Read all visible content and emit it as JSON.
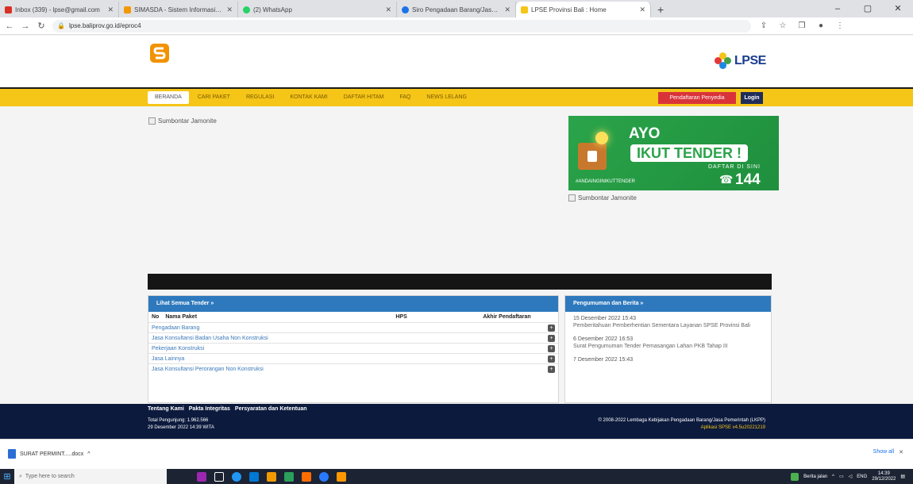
{
  "browser": {
    "tabs": [
      {
        "label": "Inbox (339) - lpse@gmail.com",
        "color": "#d93025",
        "active": false
      },
      {
        "label": "SIMASDA - Sistem Informasi Pr...",
        "color": "#f29900",
        "active": false
      },
      {
        "label": "(2) WhatsApp",
        "color": "#25d366",
        "active": false
      },
      {
        "label": "Siro Pengadaan Barang/Jasa de...",
        "color": "#1a73e8",
        "active": false
      },
      {
        "label": "LPSE Provinsi Bali : Home",
        "color": "#f5c518",
        "active": true
      }
    ],
    "new_tab": "+",
    "url": "lpse.baliprov.go.id/eproc4",
    "win_controls": [
      "–",
      "▢",
      "✕"
    ]
  },
  "site": {
    "brand_colors": {
      "yellow": "#f5c518",
      "navy": "#0c1a3d",
      "blue": "#2e79bd",
      "red": "#d9333a"
    },
    "lpse_logo": "LPSE",
    "nav": [
      {
        "label": "BERANDA",
        "active": true
      },
      {
        "label": "CARI PAKET",
        "active": false
      },
      {
        "label": "REGULASI",
        "active": false
      },
      {
        "label": "KONTAK KAMI",
        "active": false
      },
      {
        "label": "DAFTAR HITAM",
        "active": false
      },
      {
        "label": "FAQ",
        "active": false
      },
      {
        "label": "NEWS LELANG",
        "active": false
      }
    ],
    "register": "Pendaftaran Penyedia",
    "login": "Login",
    "left_banner_alt": "Sumbontar Jamonite",
    "right_banner_alt": "Sumbontar Jamonite",
    "ayo": {
      "title": "AYO",
      "subtitle": "IKUT TENDER !",
      "daftar": "DAFTAR DI SINI",
      "hashtag": "#ANDAINGINIKUTTENDER",
      "phone": "144",
      "phone_icon": "☎"
    }
  },
  "tender": {
    "header": "Lihat Semua Tender »",
    "columns": [
      "No",
      "Nama Paket",
      "HPS",
      "Akhir Pendaftaran"
    ],
    "rows": [
      "Pengadaan Barang",
      "Jasa Konsultansi Badan Usaha Non Konstruksi",
      "Pekerjaan Konstruksi",
      "Jasa Lainnya",
      "Jasa Konsultansi Perorangan Non Konstruksi"
    ],
    "row_icon": "+"
  },
  "news": {
    "header": "Pengumuman dan Berita »",
    "items": [
      {
        "date": "15 Desember 2022 15:43",
        "text": "Pemberitahuan Pemberhentian Sementara Layanan SPSE Provinsi Bali"
      },
      {
        "date": "6 Desember 2022 16:53",
        "text": "Surat Pengumuman Tender Pemasangan Lahan PKB Tahap III"
      },
      {
        "date": "7 Desember 2022 15:43",
        "text": ""
      }
    ]
  },
  "footer": {
    "links": [
      "Tentang Kami",
      "Pakta Integritas",
      "Persyaratan dan Ketentuan"
    ],
    "total": "Total Pengunjung: 1.962.566",
    "date": "29 Desember 2022 14:39 WITA",
    "copyright": "© 2008-2022 Lembaga Kebijakan Pengadaan Barang/Jasa Pemerintah (LKPP)",
    "version": "Aplikasi SPSE v4.5u20221219"
  },
  "download": {
    "file": "SURAT PERMINT.....docx",
    "caret": "^",
    "show_all": "Show all",
    "close": "✕"
  },
  "taskbar": {
    "start": "⊞",
    "search_placeholder": "Type here to search",
    "search_icon": "⌕",
    "icons": [
      "#9c27b0",
      "#ffffff",
      "#2196f3",
      "#0078d4",
      "#f29900",
      "#2b9f5b",
      "#ff6d00",
      "#2979ff",
      "#ff9800"
    ],
    "tray_text": "Berita jalan",
    "lang": "ENG",
    "time": "14:39",
    "date": "29/12/2022"
  }
}
